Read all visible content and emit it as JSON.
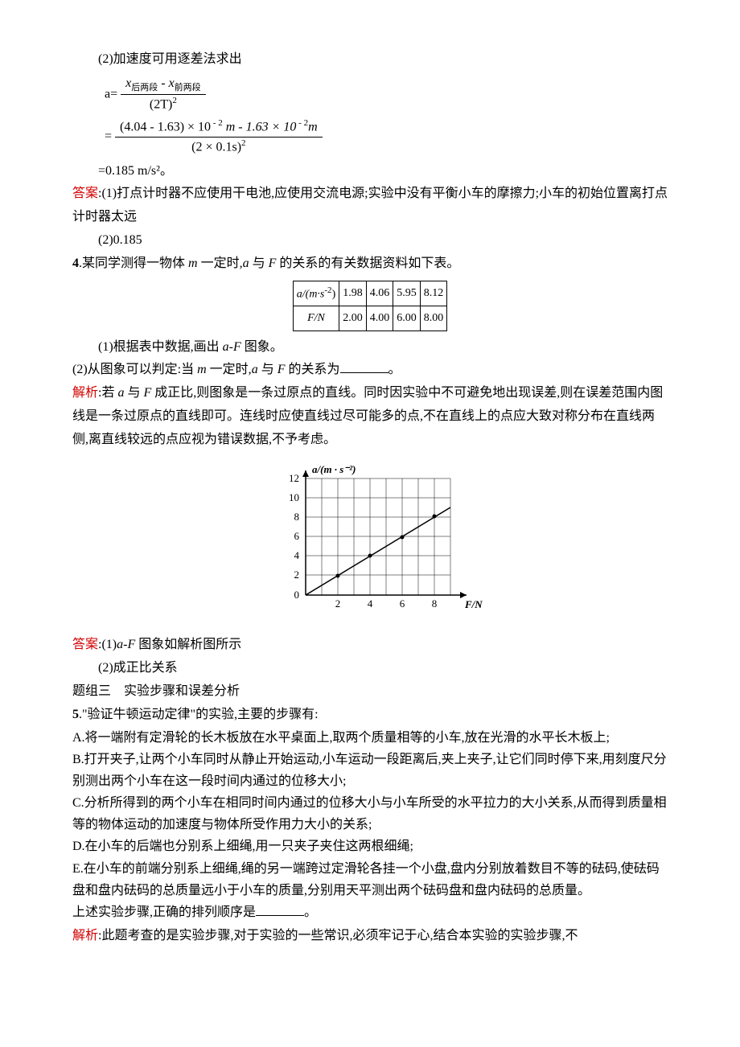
{
  "p1": "(2)加速度可用逐差法求出",
  "formula_pre": "a=",
  "formula_num1_a": "x",
  "formula_num1_sub_a": "后两段",
  "formula_num1_mid": " - ",
  "formula_num1_b": "x",
  "formula_num1_sub_b": "前两段",
  "formula_den1": "(2T)",
  "formula_den1_sup": "2",
  "formula_eq": "=",
  "formula_num2": "(4.04 - 1.63) × 10",
  "formula_num2_sup1": " - 2",
  "formula_num2_mid": " m - 1.63 × 10",
  "formula_num2_sup2": " - 2",
  "formula_num2_end": "m",
  "formula_den2": "(2 × 0.1s)",
  "formula_den2_sup": "2",
  "result_line": "=0.185 m/s²。",
  "ans1_label": "答案",
  "ans1_text": ":(1)打点计时器不应使用干电池,应使用交流电源;实验中没有平衡小车的摩擦力;小车的初始位置离打点计时器太远",
  "ans1_line2": "(2)0.185",
  "q4_num": "4",
  "q4_text_a": ".某同学测得一物体 ",
  "q4_m": "m",
  "q4_text_b": " 一定时,",
  "q4_a": "a",
  "q4_text_c": " 与 ",
  "q4_F": "F",
  "q4_text_d": " 的关系的有关数据资料如下表。",
  "table_header_a": "a/(m·s",
  "table_header_a_sup": "-2",
  "table_header_a_end": ")",
  "table_header_F": "F/N",
  "table_a_vals": [
    "1.98",
    "4.06",
    "5.95",
    "8.12"
  ],
  "table_F_vals": [
    "2.00",
    "4.00",
    "6.00",
    "8.00"
  ],
  "q4_1": "(1)根据表中数据,画出 ",
  "q4_1_aF": "a-F",
  "q4_1_end": " 图象。",
  "q4_2_a": "(2)从图象可以判定:当 ",
  "q4_2_m": "m",
  "q4_2_b": " 一定时,",
  "q4_2_a2": "a",
  "q4_2_c": " 与 ",
  "q4_2_F": "F",
  "q4_2_d": " 的关系为",
  "q4_2_end": "。",
  "analysis_label": "解析",
  "analysis_text_a": ":若 ",
  "analysis_a": "a",
  "analysis_text_b": " 与 ",
  "analysis_F": "F",
  "analysis_text_c": " 成正比,则图象是一条过原点的直线。同时因实验中不可避免地出现误差,则在误差范围内图线是一条过原点的直线即可。连线时应使直线过尽可能多的点,不在直线上的点应大致对称分布在直线两侧,离直线较远的点应视为错误数据,不予考虑。",
  "chart_data": {
    "type": "scatter",
    "title": "",
    "xlabel": "F/N",
    "ylabel": "a/(m · s⁻²)",
    "xlim": [
      0,
      10
    ],
    "ylim": [
      0,
      12
    ],
    "x_ticks": [
      2.0,
      4.0,
      6.0,
      8.0
    ],
    "y_ticks": [
      0,
      2.0,
      4.0,
      6.0,
      8.0,
      10.0,
      12.0
    ],
    "x": [
      2.0,
      4.0,
      6.0,
      8.0
    ],
    "y": [
      1.98,
      4.06,
      5.95,
      8.12
    ],
    "fit_line": {
      "x": [
        0,
        9
      ],
      "y": [
        0,
        9
      ]
    }
  },
  "ans4_label": "答案",
  "ans4_text_a": ":(1)",
  "ans4_aF": "a-F",
  "ans4_text_b": " 图象如解析图所示",
  "ans4_line2": "(2)成正比关系",
  "section3": "题组三　实验步骤和误差分析",
  "q5_num": "5",
  "q5_text": ".\"验证牛顿运动定律\"的实验,主要的步骤有:",
  "q5_A": "A.将一端附有定滑轮的长木板放在水平桌面上,取两个质量相等的小车,放在光滑的水平长木板上;",
  "q5_B": "B.打开夹子,让两个小车同时从静止开始运动,小车运动一段距离后,夹上夹子,让它们同时停下来,用刻度尺分别测出两个小车在这一段时间内通过的位移大小;",
  "q5_C": "C.分析所得到的两个小车在相同时间内通过的位移大小与小车所受的水平拉力的大小关系,从而得到质量相等的物体运动的加速度与物体所受作用力大小的关系;",
  "q5_D": "D.在小车的后端也分别系上细绳,用一只夹子夹住这两根细绳;",
  "q5_E": "E.在小车的前端分别系上细绳,绳的另一端跨过定滑轮各挂一个小盘,盘内分别放着数目不等的砝码,使砝码盘和盘内砝码的总质量远小于小车的质量,分别用天平测出两个砝码盘和盘内砝码的总质量。",
  "q5_order": "上述实验步骤,正确的排列顺序是",
  "q5_order_end": "。",
  "analysis5_label": "解析",
  "analysis5_text": ":此题考查的是实验步骤,对于实验的一些常识,必须牢记于心,结合本实验的实验步骤,不"
}
